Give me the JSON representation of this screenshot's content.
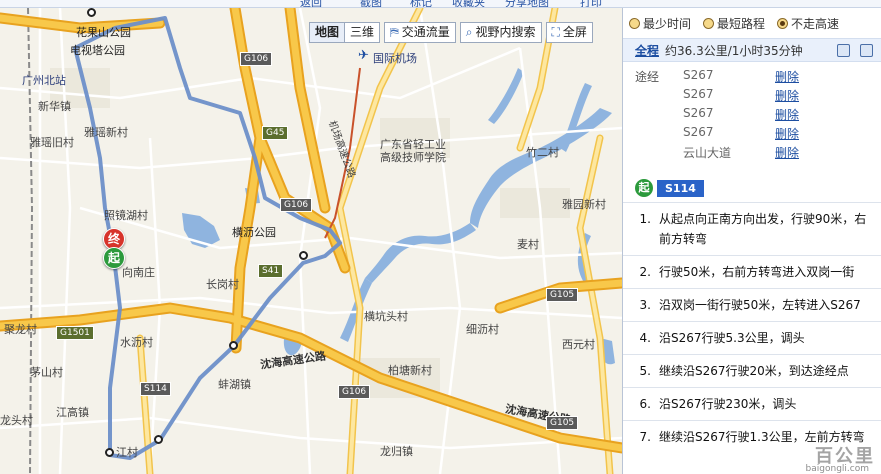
{
  "toolbar_top": {
    "items": [
      "返回",
      "截图",
      "标记",
      "收藏夹",
      "分享地图",
      "打印"
    ]
  },
  "map_tools": {
    "map_label": "地图",
    "three_d_label": "三维",
    "traffic_label": "交通流量",
    "search_view_label": "视野内搜索",
    "fullscreen_label": "全屏"
  },
  "map_labels": {
    "place1": "花果山公园",
    "place2": "电视塔公园",
    "place3": "广州北站",
    "place4": "新华镇",
    "place5": "雅瑶旧村",
    "place6": "雅瑶新村",
    "place7": "照镜湖村",
    "place8": "横沥公园",
    "place9": "向南庄",
    "place10": "长岗村",
    "place11": "聚龙村",
    "place12": "水沥村",
    "place13": "茅山村",
    "place14": "蚌湖镇",
    "place15": "江高镇",
    "place16": "龙头村",
    "place17": "江村",
    "place18": "国际机场",
    "place19": "机场高速公路",
    "place20": "广东省轻工业高级技师学院",
    "place21": "竹二村",
    "place22": "雅园新村",
    "place23": "麦村",
    "place24": "横坑头村",
    "place25": "细沥村",
    "place26": "西元村",
    "place27": "柏塘新村",
    "place28": "龙归镇",
    "hw1": "沈海高速公路",
    "hw2": "沈海高速公路"
  },
  "road_badges": [
    "G106",
    "G45",
    "G106",
    "S41",
    "G1501",
    "S114",
    "G106",
    "G105",
    "G105"
  ],
  "route_options": {
    "opt1": "最少时间",
    "opt2": "最短路程",
    "opt3": "不走高速",
    "selected": "opt3"
  },
  "summary": {
    "full_label": "全程",
    "text": "约36.3公里/1小时35分钟"
  },
  "via": {
    "label": "途经",
    "delete_label": "删除",
    "items": [
      "S267",
      "S267",
      "S267",
      "S267",
      "云山大道"
    ]
  },
  "start": {
    "icon_text": "起",
    "road": "S114"
  },
  "markers": {
    "end": "终",
    "start": "起"
  },
  "steps": [
    {
      "n": "1.",
      "text": "从起点向正南方向出发，行驶90米，右前方转弯"
    },
    {
      "n": "2.",
      "text": "行驶50米，右前方转弯进入双岗一街"
    },
    {
      "n": "3.",
      "text": "沿双岗一街行驶50米，左转进入S267"
    },
    {
      "n": "4.",
      "text": "沿S267行驶5.3公里，调头"
    },
    {
      "n": "5.",
      "text": "继续沿S267行驶20米，到达途经点"
    },
    {
      "n": "6.",
      "text": "沿S267行驶230米，调头"
    },
    {
      "n": "7.",
      "text": "继续沿S267行驶1.3公里，左前方转弯"
    }
  ],
  "watermark": {
    "main": "百公里",
    "sub": "baigongli.com"
  },
  "colors": {
    "route": "#6d8fc9",
    "highway": "#f5b82e",
    "provincial": "#fbe08a",
    "water": "#7fa9d9",
    "accent": "#1d4ea1"
  }
}
